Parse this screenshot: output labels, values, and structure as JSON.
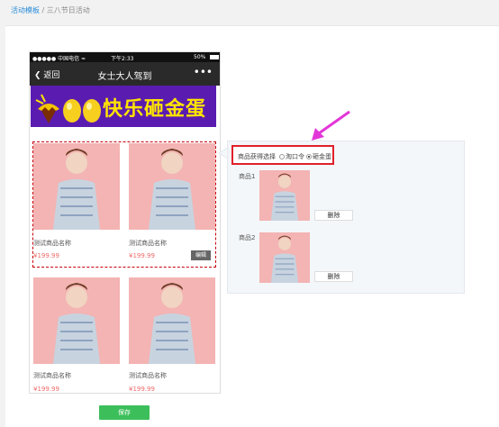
{
  "breadcrumb": {
    "link": "活动模板",
    "sep": " / ",
    "current": "三八节日活动"
  },
  "status_bar": {
    "carrier": "●●●●● 中国电信 ≈",
    "time": "下午2:33",
    "battery": "50%"
  },
  "navbar": {
    "back": "返回",
    "title": "女士大人驾到",
    "more": "•••"
  },
  "banner": {
    "text": "快乐砸金蛋"
  },
  "products": [
    {
      "name": "测试商品名称",
      "price": "¥199.99"
    },
    {
      "name": "测试商品名称",
      "price": "¥199.99"
    },
    {
      "name": "测试商品名称",
      "price": "¥199.99"
    },
    {
      "name": "测试商品名称",
      "price": "¥199.99"
    }
  ],
  "edit_label": "编辑",
  "save_label": "保存",
  "panel": {
    "select_label": "商品获得选择",
    "options": [
      {
        "label": "淘口令",
        "selected": false
      },
      {
        "label": "砸金蛋",
        "selected": true
      }
    ],
    "items": [
      {
        "label": "商品1",
        "delete": "删除"
      },
      {
        "label": "商品2",
        "delete": "删除"
      }
    ]
  },
  "colors": {
    "accent_red": "#e0202a",
    "save_green": "#3cbf5a",
    "banner_purple": "#5a1cb0",
    "arrow_pink": "#e336d8"
  }
}
